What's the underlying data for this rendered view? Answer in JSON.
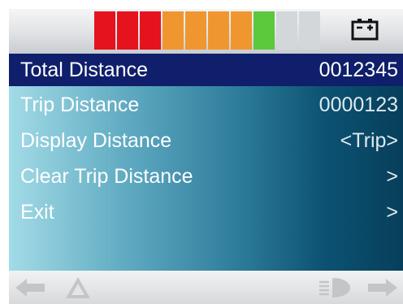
{
  "status_bar": {
    "charge_segments": [
      {
        "color": "#e4131e"
      },
      {
        "color": "#e4131e"
      },
      {
        "color": "#e4131e"
      },
      {
        "color": "#f09630"
      },
      {
        "color": "#f09630"
      },
      {
        "color": "#f09630"
      },
      {
        "color": "#f09630"
      },
      {
        "color": "#5cc83c"
      },
      {
        "color": "#d4d7da"
      },
      {
        "color": "#d4d7da"
      }
    ],
    "charge_level_segments": 8,
    "battery_icon": "battery-icon"
  },
  "menu": {
    "items": [
      {
        "label": "Total Distance",
        "value": "0012345",
        "selected": true
      },
      {
        "label": "Trip Distance",
        "value": "0000123",
        "selected": false
      },
      {
        "label": "Display Distance",
        "value": "<Trip>",
        "selected": false
      },
      {
        "label": "Clear Trip Distance",
        "value": ">",
        "selected": false
      },
      {
        "label": "Exit",
        "value": ">",
        "selected": false
      }
    ]
  },
  "bottom_bar": {
    "icons": [
      "left-arrow-icon",
      "warning-triangle-icon",
      "horn-icon",
      "right-arrow-icon"
    ]
  },
  "colors": {
    "selected_row": "#0f1f6b",
    "text": "#ffffff"
  }
}
